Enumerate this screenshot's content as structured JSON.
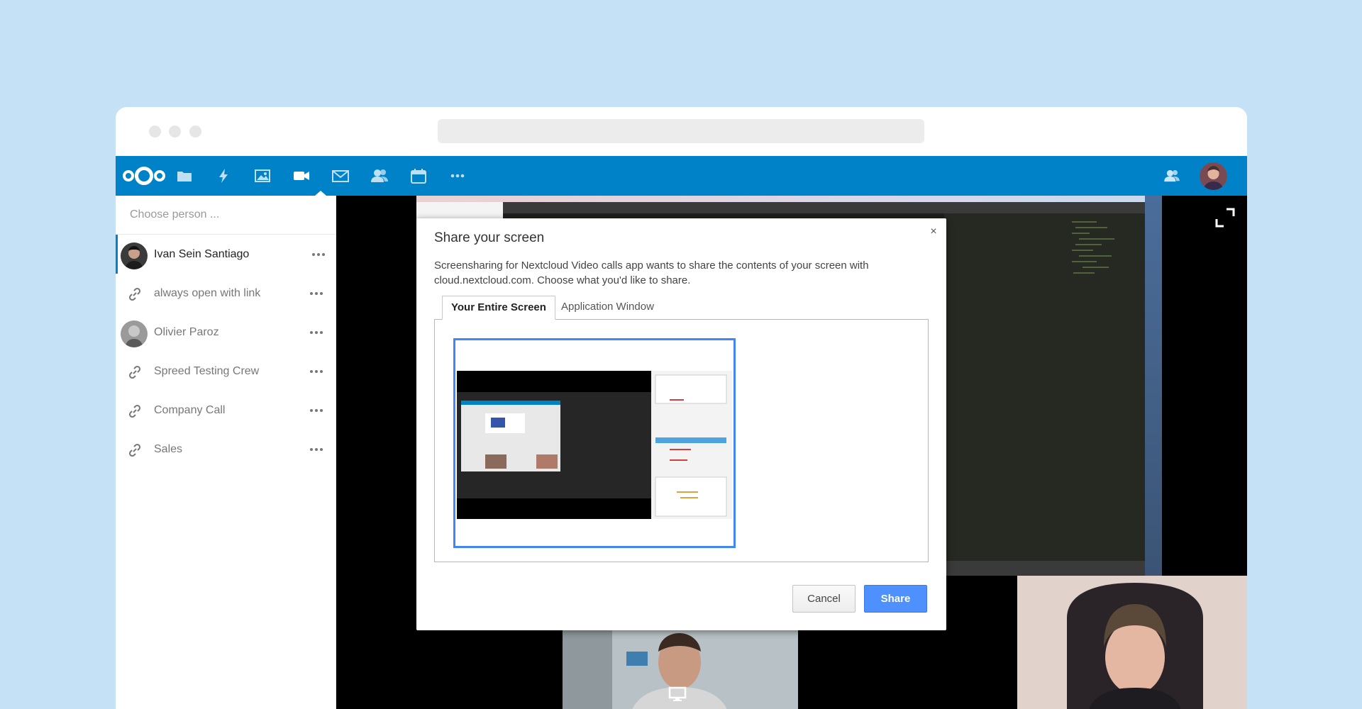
{
  "app": {
    "brand_color": "#0082c9",
    "nav_icons": [
      "folder-icon",
      "activity-icon",
      "gallery-icon",
      "video-call-icon",
      "mail-icon",
      "contacts-icon",
      "calendar-icon",
      "more-apps-icon"
    ],
    "active_app": "video-call-icon"
  },
  "sidebar": {
    "search_placeholder": "Choose person ...",
    "rooms": [
      {
        "name": "Ivan Sein Santiago",
        "type": "user",
        "active": true
      },
      {
        "name": "always open with link",
        "type": "link"
      },
      {
        "name": "Olivier Paroz",
        "type": "user"
      },
      {
        "name": "Spreed Testing Crew",
        "type": "link"
      },
      {
        "name": "Company Call",
        "type": "link"
      },
      {
        "name": "Sales",
        "type": "link"
      }
    ]
  },
  "dialog": {
    "title": "Share your screen",
    "description": "Screensharing for Nextcloud Video calls app wants to share the contents of your screen with cloud.nextcloud.com. Choose what you'd like to share.",
    "tabs": [
      "Your Entire Screen",
      "Application Window"
    ],
    "cancel_label": "Cancel",
    "share_label": "Share",
    "close_glyph": "×",
    "accent_color": "#4d90fe"
  }
}
